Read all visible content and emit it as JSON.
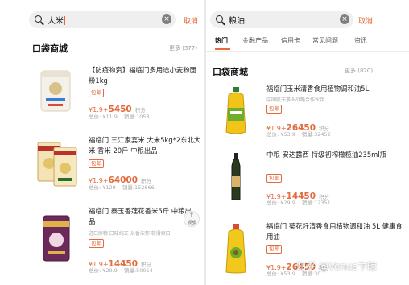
{
  "left": {
    "search_text": "大米",
    "cancel_label": "取消",
    "section_title": "口袋商城",
    "more_label": "更多 (577)",
    "products": [
      {
        "title": "【防疫物资】福临门多用途小麦粉面粉1kg",
        "badge": "包邮",
        "sub": "",
        "price_prefix": "¥1.9+",
        "points": "5450",
        "points_unit": "积分",
        "total": "总价: ¥11.9",
        "sales": "销量:1058"
      },
      {
        "title": "福临门 三江家宴米 大米5kg*2东北大米 香米 20斤 中粮出品",
        "badge": "包邮",
        "sub": "",
        "price_prefix": "¥1.9+",
        "points": "64000",
        "points_unit": "积分",
        "total": "总价: ¥129",
        "sales": "销量:152666"
      },
      {
        "title": "福临门 泰玉香莲花香米5斤 中粮出品",
        "badge": "包邮",
        "sub": "进口原粮 口味纯正 米香浓郁 软滑爽口",
        "price_prefix": "¥1.9+",
        "points": "14450",
        "points_unit": "积分",
        "total": "总价: ¥29.9",
        "sales": "销量:50054"
      }
    ],
    "top_button": {
      "arrow": "↑",
      "label": "顶部"
    }
  },
  "right": {
    "search_text": "粮油",
    "cancel_label": "取消",
    "tabs": [
      "热门",
      "金融产品",
      "信用卡",
      "常见问题",
      "资讯"
    ],
    "section_title": "口袋商城",
    "more_label": "更多 (820)",
    "products": [
      {
        "title": "福临门玉米清香食用植物调和油5L",
        "badge": "包邮",
        "sub": "中国航天事业战略合作伙伴",
        "price_prefix": "¥1.9+",
        "points": "26450",
        "points_unit": "积分",
        "total": "总价: ¥53.9",
        "sales": "销量:32452"
      },
      {
        "title": "中粮 安达露西 特级初榨橄榄油235ml瓶",
        "badge": "包邮",
        "sub": "",
        "price_prefix": "¥1.9+",
        "points": "14450",
        "points_unit": "积分",
        "total": "总价: ¥29.9",
        "sales": "销量:12351"
      },
      {
        "title": "福临门 葵花籽清香食用植物调和油 5L 健康食用油",
        "badge": "包邮",
        "sub": "",
        "price_prefix": "¥1.9+",
        "points": "26450",
        "points_unit": "积分",
        "total": "总价: ¥53.9",
        "sales": "销量:30..."
      }
    ]
  },
  "watermark": "知乎 @Venus卞晾",
  "colors": {
    "accent": "#e36a3c",
    "muted": "#aaaaaa",
    "oil_yellow": "#e6b80e",
    "oil_green": "#6fae2a"
  }
}
